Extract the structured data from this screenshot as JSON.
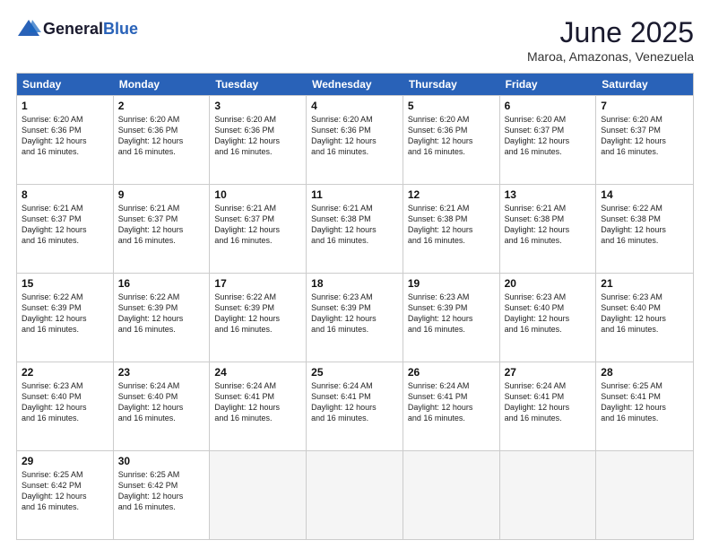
{
  "header": {
    "logo_general": "General",
    "logo_blue": "Blue",
    "month_title": "June 2025",
    "location": "Maroa, Amazonas, Venezuela"
  },
  "days": [
    "Sunday",
    "Monday",
    "Tuesday",
    "Wednesday",
    "Thursday",
    "Friday",
    "Saturday"
  ],
  "rows": [
    [
      {
        "day": "1",
        "sunrise": "6:20 AM",
        "sunset": "6:36 PM",
        "daylight": "12 hours and 16 minutes."
      },
      {
        "day": "2",
        "sunrise": "6:20 AM",
        "sunset": "6:36 PM",
        "daylight": "12 hours and 16 minutes."
      },
      {
        "day": "3",
        "sunrise": "6:20 AM",
        "sunset": "6:36 PM",
        "daylight": "12 hours and 16 minutes."
      },
      {
        "day": "4",
        "sunrise": "6:20 AM",
        "sunset": "6:36 PM",
        "daylight": "12 hours and 16 minutes."
      },
      {
        "day": "5",
        "sunrise": "6:20 AM",
        "sunset": "6:36 PM",
        "daylight": "12 hours and 16 minutes."
      },
      {
        "day": "6",
        "sunrise": "6:20 AM",
        "sunset": "6:37 PM",
        "daylight": "12 hours and 16 minutes."
      },
      {
        "day": "7",
        "sunrise": "6:20 AM",
        "sunset": "6:37 PM",
        "daylight": "12 hours and 16 minutes."
      }
    ],
    [
      {
        "day": "8",
        "sunrise": "6:21 AM",
        "sunset": "6:37 PM",
        "daylight": "12 hours and 16 minutes."
      },
      {
        "day": "9",
        "sunrise": "6:21 AM",
        "sunset": "6:37 PM",
        "daylight": "12 hours and 16 minutes."
      },
      {
        "day": "10",
        "sunrise": "6:21 AM",
        "sunset": "6:37 PM",
        "daylight": "12 hours and 16 minutes."
      },
      {
        "day": "11",
        "sunrise": "6:21 AM",
        "sunset": "6:38 PM",
        "daylight": "12 hours and 16 minutes."
      },
      {
        "day": "12",
        "sunrise": "6:21 AM",
        "sunset": "6:38 PM",
        "daylight": "12 hours and 16 minutes."
      },
      {
        "day": "13",
        "sunrise": "6:21 AM",
        "sunset": "6:38 PM",
        "daylight": "12 hours and 16 minutes."
      },
      {
        "day": "14",
        "sunrise": "6:22 AM",
        "sunset": "6:38 PM",
        "daylight": "12 hours and 16 minutes."
      }
    ],
    [
      {
        "day": "15",
        "sunrise": "6:22 AM",
        "sunset": "6:39 PM",
        "daylight": "12 hours and 16 minutes."
      },
      {
        "day": "16",
        "sunrise": "6:22 AM",
        "sunset": "6:39 PM",
        "daylight": "12 hours and 16 minutes."
      },
      {
        "day": "17",
        "sunrise": "6:22 AM",
        "sunset": "6:39 PM",
        "daylight": "12 hours and 16 minutes."
      },
      {
        "day": "18",
        "sunrise": "6:23 AM",
        "sunset": "6:39 PM",
        "daylight": "12 hours and 16 minutes."
      },
      {
        "day": "19",
        "sunrise": "6:23 AM",
        "sunset": "6:39 PM",
        "daylight": "12 hours and 16 minutes."
      },
      {
        "day": "20",
        "sunrise": "6:23 AM",
        "sunset": "6:40 PM",
        "daylight": "12 hours and 16 minutes."
      },
      {
        "day": "21",
        "sunrise": "6:23 AM",
        "sunset": "6:40 PM",
        "daylight": "12 hours and 16 minutes."
      }
    ],
    [
      {
        "day": "22",
        "sunrise": "6:23 AM",
        "sunset": "6:40 PM",
        "daylight": "12 hours and 16 minutes."
      },
      {
        "day": "23",
        "sunrise": "6:24 AM",
        "sunset": "6:40 PM",
        "daylight": "12 hours and 16 minutes."
      },
      {
        "day": "24",
        "sunrise": "6:24 AM",
        "sunset": "6:41 PM",
        "daylight": "12 hours and 16 minutes."
      },
      {
        "day": "25",
        "sunrise": "6:24 AM",
        "sunset": "6:41 PM",
        "daylight": "12 hours and 16 minutes."
      },
      {
        "day": "26",
        "sunrise": "6:24 AM",
        "sunset": "6:41 PM",
        "daylight": "12 hours and 16 minutes."
      },
      {
        "day": "27",
        "sunrise": "6:24 AM",
        "sunset": "6:41 PM",
        "daylight": "12 hours and 16 minutes."
      },
      {
        "day": "28",
        "sunrise": "6:25 AM",
        "sunset": "6:41 PM",
        "daylight": "12 hours and 16 minutes."
      }
    ],
    [
      {
        "day": "29",
        "sunrise": "6:25 AM",
        "sunset": "6:42 PM",
        "daylight": "12 hours and 16 minutes."
      },
      {
        "day": "30",
        "sunrise": "6:25 AM",
        "sunset": "6:42 PM",
        "daylight": "12 hours and 16 minutes."
      },
      null,
      null,
      null,
      null,
      null
    ]
  ],
  "labels": {
    "sunrise": "Sunrise:",
    "sunset": "Sunset:",
    "daylight": "Daylight:"
  }
}
